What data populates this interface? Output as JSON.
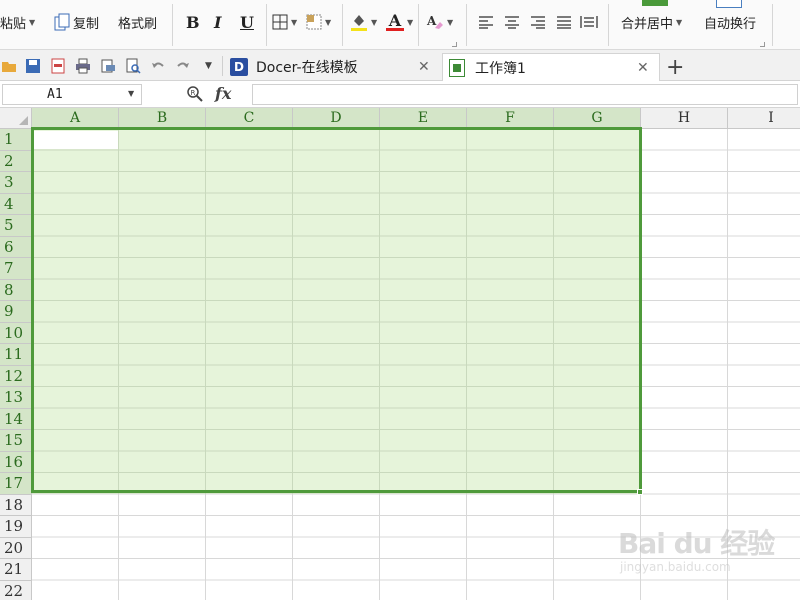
{
  "ribbon": {
    "paste_label": "粘贴",
    "copy_label": "复制",
    "format_painter_label": "格式刷",
    "bold": "B",
    "italic": "I",
    "underline": "U",
    "font_color_glyph": "A",
    "merge_center_label": "合并居中",
    "wrap_text_label": "自动换行",
    "font_color_bar": "#e02020",
    "highlight_bar": "#f4e21a"
  },
  "tabs": [
    {
      "label": "Docer-在线模板",
      "icon": "docer-icon",
      "active": false
    },
    {
      "label": "工作簿1",
      "icon": "spreadsheet-icon",
      "active": true
    }
  ],
  "formula_bar": {
    "name_box": "A1",
    "fx_label": "fx",
    "value": ""
  },
  "sheet": {
    "columns": [
      "A",
      "B",
      "C",
      "D",
      "E",
      "F",
      "G",
      "H",
      "I"
    ],
    "rows": [
      "1",
      "2",
      "3",
      "4",
      "5",
      "6",
      "7",
      "8",
      "9",
      "10",
      "11",
      "12",
      "13",
      "14",
      "15",
      "16",
      "17",
      "18",
      "19",
      "20",
      "21",
      "22"
    ],
    "selection": "A1:G17",
    "accent": "#4f9a3b",
    "selection_fill": "#e6f4da"
  },
  "watermark": {
    "logo": "Bai du 经验",
    "url": "jingyan.baidu.com"
  }
}
